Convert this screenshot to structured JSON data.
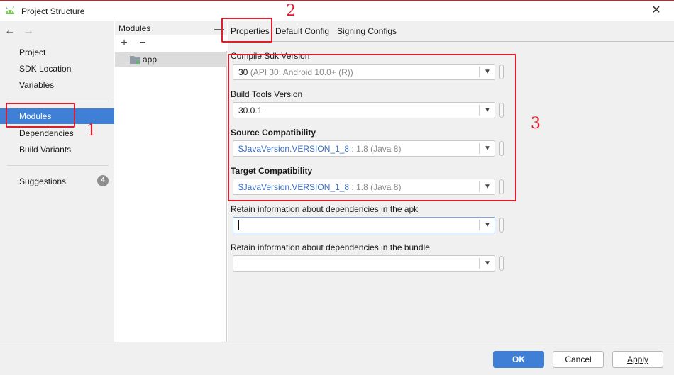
{
  "window": {
    "title": "Project Structure",
    "close_glyph": "✕"
  },
  "nav": {
    "back_glyph": "←",
    "forward_glyph": "→",
    "items": [
      {
        "label": "Project"
      },
      {
        "label": "SDK Location"
      },
      {
        "label": "Variables"
      },
      {
        "label": "Modules",
        "selected": true
      },
      {
        "label": "Dependencies"
      },
      {
        "label": "Build Variants"
      },
      {
        "label": "Suggestions",
        "badge": "4"
      }
    ]
  },
  "modules_panel": {
    "title": "Modules",
    "collapse_glyph": "—",
    "add_glyph": "+",
    "remove_glyph": "−",
    "items": [
      {
        "label": "app"
      }
    ]
  },
  "tabs": [
    {
      "label": "Properties",
      "selected": true
    },
    {
      "label": "Default Config"
    },
    {
      "label": "Signing Configs"
    }
  ],
  "fields": [
    {
      "label": "Compile Sdk Version",
      "value": "30",
      "hint": " (API 30: Android 10.0+ (R))",
      "bold": false
    },
    {
      "label": "Build Tools Version",
      "value": "30.0.1",
      "hint": "",
      "bold": false
    },
    {
      "label": "Source Compatibility",
      "value": "$JavaVersion.VERSION_1_8",
      "hint": " : 1.8 (Java 8)",
      "bold": true
    },
    {
      "label": "Target Compatibility",
      "value": "$JavaVersion.VERSION_1_8",
      "hint": " : 1.8 (Java 8)",
      "bold": true
    },
    {
      "label": "Retain information about dependencies in the apk",
      "value": "",
      "hint": "",
      "bold": false
    },
    {
      "label": "Retain information about dependencies in the bundle",
      "value": "",
      "hint": "",
      "bold": false
    }
  ],
  "buttons": {
    "ok": "OK",
    "cancel": "Cancel",
    "apply": "Apply"
  },
  "annotations": {
    "one": "1",
    "two": "2",
    "three": "3"
  },
  "colors": {
    "accent": "#3f7fd6",
    "annotation": "#e01e2b",
    "value_blue": "#3b6fc4"
  }
}
